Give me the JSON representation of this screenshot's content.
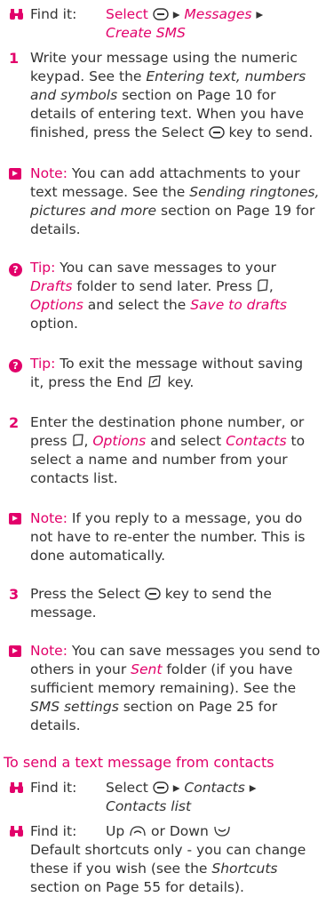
{
  "find1": {
    "label": "Find it:",
    "select": "Select",
    "arrow": "▸",
    "messages": "Messages",
    "create": "Create SMS"
  },
  "step1": {
    "num": "1",
    "text_a": "Write your message using the numeric keypad. See the ",
    "link": "Entering text, numbers and symbols",
    "text_b": " section on Page 10 for details of entering text. When you have finished, press the Select ",
    "text_c": " key to send."
  },
  "note1": {
    "label": "Note:",
    "text_a": " You can add attachments to your text message. See the ",
    "link": "Sending ringtones, pictures and more",
    "text_b": " section on Page 19 for details."
  },
  "tip1": {
    "label": "Tip:",
    "text_a": " You can save messages to your ",
    "drafts": "Drafts",
    "text_b": " folder to send later. Press ",
    "options": "Options",
    "text_c": " and select the ",
    "save": "Save to drafts",
    "text_d": " option."
  },
  "tip2": {
    "label": "Tip:",
    "text_a": " To exit the message without saving it, press the End ",
    "text_b": " key."
  },
  "step2": {
    "num": "2",
    "text_a": "Enter the destination phone number, or press ",
    "options": "Options",
    "text_b": " and select ",
    "contacts": "Contacts",
    "text_c": " to select a name and number from your contacts list."
  },
  "note2": {
    "label": "Note:",
    "text": " If you reply to a message, you do not have to re-enter the number. This is done automatically."
  },
  "step3": {
    "num": "3",
    "text_a": "Press the Select ",
    "text_b": " key to send the message."
  },
  "note3": {
    "label": "Note:",
    "text_a": " You can save messages you send to others in your ",
    "sent": "Sent",
    "text_b": " folder (if you have sufficient memory remaining). See the ",
    "link": "SMS settings",
    "text_c": " section on Page 25 for details."
  },
  "heading": "To send a text message from contacts",
  "find2": {
    "label": "Find it:",
    "select": "Select",
    "contacts": "Contacts",
    "arrow": "▸",
    "list": "Contacts list"
  },
  "find3": {
    "label": "Find it:",
    "up": "Up",
    "or": " or ",
    "down": "Down",
    "text_a": "Default shortcuts only - you can change these if you wish (see the ",
    "link": "Shortcuts",
    "text_b": " section on Page 55 for details)."
  },
  "icons": [
    "binoculars-icon",
    "note-icon",
    "tip-icon",
    "select-key-icon",
    "softkey-icon",
    "end-key-icon",
    "up-key-icon",
    "down-key-icon"
  ],
  "colors": {
    "accent": "#e2006a",
    "text": "#333333"
  }
}
